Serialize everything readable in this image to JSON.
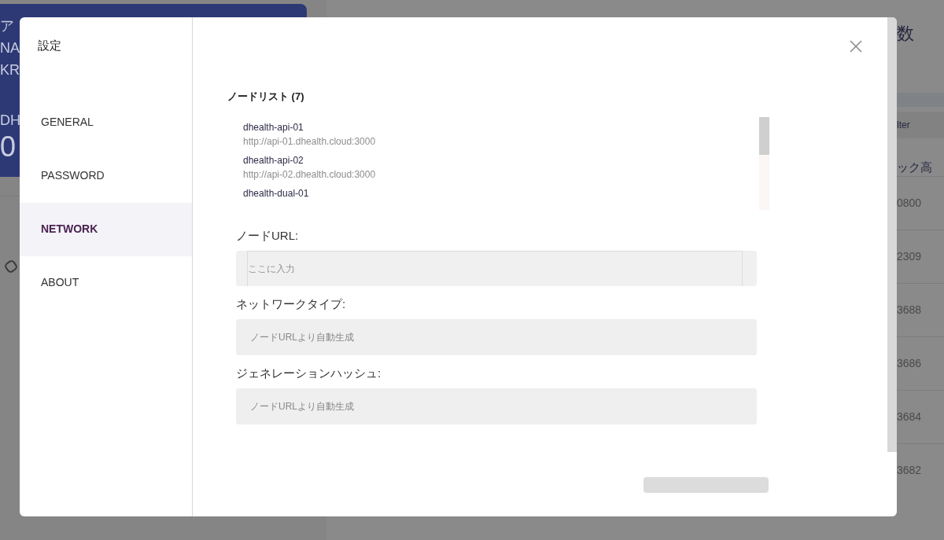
{
  "background": {
    "left_card_lines": [
      "ア",
      "NA",
      "KR"
    ],
    "left_card_label": "DH",
    "left_card_value": "0",
    "right_title": "数",
    "right_filter": "lter",
    "right_column_header": "ック高",
    "right_cells": [
      "0800",
      "2309",
      "3688",
      "3686",
      "3684",
      "3682"
    ]
  },
  "modal": {
    "title": "設定",
    "menu": [
      {
        "label": "GENERAL",
        "selected": false
      },
      {
        "label": "PASSWORD",
        "selected": false
      },
      {
        "label": "NETWORK",
        "selected": true
      },
      {
        "label": "ABOUT",
        "selected": false
      }
    ],
    "node_list": {
      "title": "ノードリスト (7)",
      "items": [
        {
          "name": "dhealth-api-01",
          "url": "http://api-01.dhealth.cloud:3000"
        },
        {
          "name": "dhealth-api-02",
          "url": "http://api-02.dhealth.cloud:3000"
        },
        {
          "name": "dhealth-dual-01"
        }
      ]
    },
    "fields": [
      {
        "label": "ノードURL:",
        "placeholder": "ここに入力",
        "kind": "input"
      },
      {
        "label": "ネットワークタイプ:",
        "placeholder": "ノードURLより自動生成",
        "kind": "readonly"
      },
      {
        "label": "ジェネレーションハッシュ:",
        "placeholder": "ノードURLより自動生成",
        "kind": "readonly"
      }
    ]
  }
}
